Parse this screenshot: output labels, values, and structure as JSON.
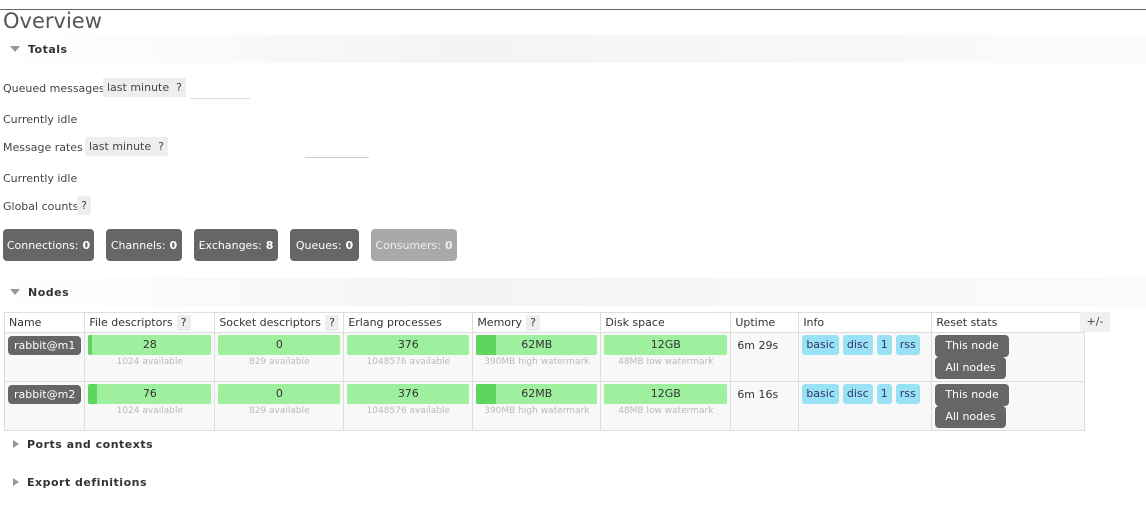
{
  "page": {
    "title": "Overview"
  },
  "totals": {
    "section_label": "Totals",
    "queued_messages_label": "Queued messages",
    "queued_range": "last minute",
    "help": "?",
    "queued_status": "Currently idle",
    "message_rates_label": "Message rates",
    "rates_range": "last minute",
    "rates_status": "Currently idle",
    "global_counts_label": "Global counts",
    "counts": [
      {
        "label": "Connections:",
        "value": "0"
      },
      {
        "label": "Channels:",
        "value": "0"
      },
      {
        "label": "Exchanges:",
        "value": "8"
      },
      {
        "label": "Queues:",
        "value": "0"
      },
      {
        "label": "Consumers:",
        "value": "0"
      }
    ]
  },
  "nodes": {
    "section_label": "Nodes",
    "plus_minus": "+/-",
    "columns": {
      "name": "Name",
      "file_descriptors": "File descriptors",
      "socket_descriptors": "Socket descriptors",
      "erlang_processes": "Erlang processes",
      "memory": "Memory",
      "disk_space": "Disk space",
      "uptime": "Uptime",
      "info": "Info",
      "reset_stats": "Reset stats",
      "help": "?"
    },
    "rows": [
      {
        "name": "rabbit@m1",
        "fd": "28",
        "fd_sub": "1024 available",
        "fd_fill": 0.027,
        "sockets": "0",
        "sockets_sub": "829 available",
        "sockets_fill": 0,
        "procs": "376",
        "procs_sub": "1048576 available",
        "procs_fill": 0,
        "memory": "62MB",
        "memory_sub": "390MB high watermark",
        "memory_fill": 0.16,
        "disk": "12GB",
        "disk_sub": "48MB low watermark",
        "disk_fill": 0,
        "uptime": "6m 29s",
        "info": [
          "basic",
          "disc",
          "1",
          "rss"
        ],
        "reset_this": "This node",
        "reset_all": "All nodes"
      },
      {
        "name": "rabbit@m2",
        "fd": "76",
        "fd_sub": "1024 available",
        "fd_fill": 0.074,
        "sockets": "0",
        "sockets_sub": "829 available",
        "sockets_fill": 0,
        "procs": "376",
        "procs_sub": "1048576 available",
        "procs_fill": 0,
        "memory": "62MB",
        "memory_sub": "390MB high watermark",
        "memory_fill": 0.16,
        "disk": "12GB",
        "disk_sub": "48MB low watermark",
        "disk_fill": 0,
        "uptime": "6m 16s",
        "info": [
          "basic",
          "disc",
          "1",
          "rss"
        ],
        "reset_this": "This node",
        "reset_all": "All nodes"
      }
    ]
  },
  "collapsed_sections": {
    "ports": "Ports and contexts",
    "export": "Export definitions"
  }
}
